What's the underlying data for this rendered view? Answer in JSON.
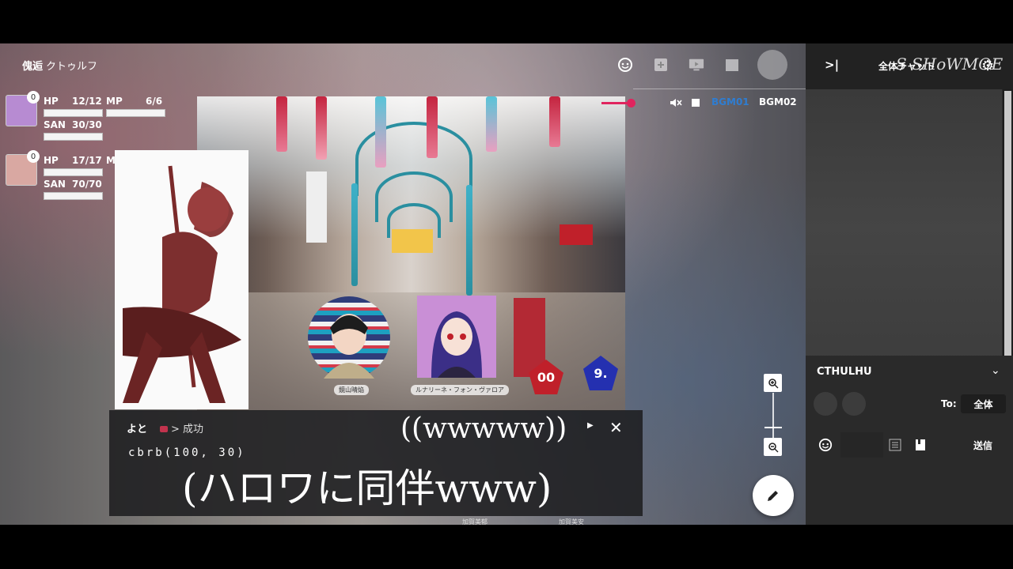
{
  "room": {
    "title": "傀逅",
    "system": "クトゥルフ"
  },
  "bgm": {
    "tabs": [
      "BGM01",
      "BGM02"
    ],
    "active": "BGM01",
    "active_color": "#2f7dd1"
  },
  "characters": [
    {
      "hp_label": "HP",
      "hp": "12/12",
      "mp_label": "MP",
      "mp": "6/6",
      "san_label": "SAN",
      "san": "30/30",
      "badge": "0"
    },
    {
      "hp_label": "HP",
      "hp": "17/17",
      "mp_label": "M",
      "san_label": "SAN",
      "san": "70/70",
      "badge": "0"
    }
  ],
  "tokens": [
    {
      "name": "鏡山晴焔"
    },
    {
      "name": "ルナリーネ・フォン・ヴァロア"
    }
  ],
  "dice": [
    {
      "face": "00",
      "color": "#c0202a"
    },
    {
      "face": "9.",
      "color": "#2430b0"
    }
  ],
  "message": {
    "speaker": "よと",
    "result": "> 成功",
    "command": "cbrb(100, 30)"
  },
  "subtitles": {
    "line1": "((wwwww))",
    "line2": "(ハロワに同伴www)"
  },
  "under_labels": [
    "加賀美郁",
    "加賀美安"
  ],
  "sidebar": {
    "channel_label": "全体チャット",
    "watermark": "S SHoWMOE",
    "system_name": "CTHULHU",
    "to_label": "To:",
    "to_value": "全体",
    "send_label": "送信"
  },
  "colors": {
    "accent": "#e0245e"
  }
}
